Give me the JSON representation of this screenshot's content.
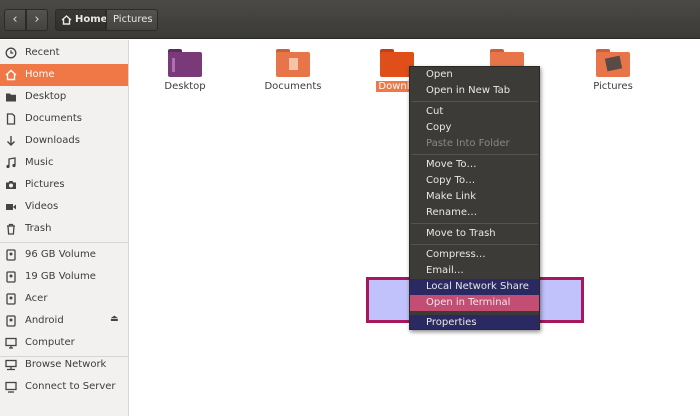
{
  "header": {
    "back_icon": "chevron-left-icon",
    "forward_icon": "chevron-right-icon",
    "breadcrumb": {
      "home": "Home",
      "current": "Pictures"
    }
  },
  "sidebar": {
    "items": [
      {
        "label": "Recent",
        "icon": "clock-icon"
      },
      {
        "label": "Home",
        "icon": "home-icon",
        "active": true
      },
      {
        "label": "Desktop",
        "icon": "folder-icon"
      },
      {
        "label": "Documents",
        "icon": "document-icon"
      },
      {
        "label": "Downloads",
        "icon": "download-arrow-icon"
      },
      {
        "label": "Music",
        "icon": "music-note-icon"
      },
      {
        "label": "Pictures",
        "icon": "camera-icon"
      },
      {
        "label": "Videos",
        "icon": "video-icon"
      },
      {
        "label": "Trash",
        "icon": "trash-icon"
      },
      {
        "label": "96 GB Volume",
        "icon": "drive-icon"
      },
      {
        "label": "19 GB Volume",
        "icon": "drive-icon"
      },
      {
        "label": "Acer",
        "icon": "drive-icon"
      },
      {
        "label": "Android",
        "icon": "drive-icon",
        "eject": true
      },
      {
        "label": "Computer",
        "icon": "computer-icon"
      },
      {
        "label": "Browse Network",
        "icon": "network-icon"
      },
      {
        "label": "Connect to Server",
        "icon": "server-icon"
      }
    ]
  },
  "files": [
    {
      "label": "Desktop",
      "color": "#7a3a7a"
    },
    {
      "label": "Documents",
      "color": "#e8754a"
    },
    {
      "label": "Downlo",
      "color": "#e04e1a",
      "selected": true
    },
    {
      "label": "",
      "color": "#e8754a"
    },
    {
      "label": "Pictures",
      "color": "#e8754a"
    }
  ],
  "context_menu": {
    "items": [
      {
        "label": "Open"
      },
      {
        "label": "Open in New Tab"
      },
      {
        "label": "Cut"
      },
      {
        "label": "Copy"
      },
      {
        "label": "Paste Into Folder",
        "disabled": true
      },
      {
        "label": "Move To…"
      },
      {
        "label": "Copy To…"
      },
      {
        "label": "Make Link"
      },
      {
        "label": "Rename…"
      },
      {
        "label": "Move to Trash"
      },
      {
        "label": "Compress…"
      },
      {
        "label": "Email…"
      },
      {
        "label": "Local Network Share"
      },
      {
        "label": "Open in Terminal"
      },
      {
        "label": "Properties"
      }
    ]
  },
  "colors": {
    "accent": "#f07746",
    "menu_bg": "#3c3b37",
    "highlight_box": "#c1c1fb",
    "highlight_border": "#a6175d",
    "terminal_item": "#c34d73"
  }
}
